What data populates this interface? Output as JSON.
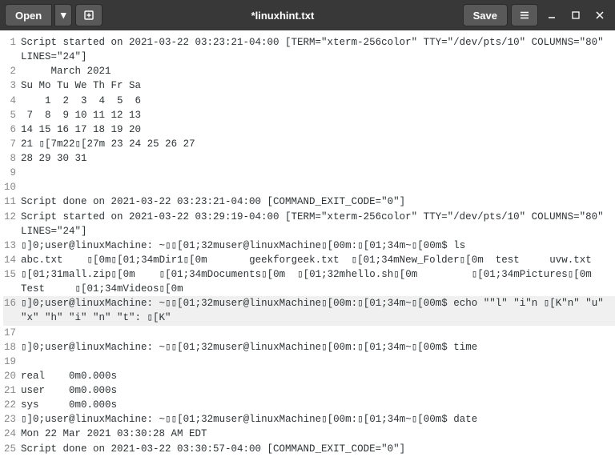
{
  "titlebar": {
    "open_label": "Open",
    "title": "*linuxhint.txt",
    "save_label": "Save"
  },
  "lines": [
    {
      "n": "1",
      "t": "Script started on 2021-03-22 03:23:21-04:00 [TERM=\"xterm-256color\" TTY=\"/dev/pts/10\" COLUMNS=\"80\" LINES=\"24\"]"
    },
    {
      "n": "2",
      "t": "     March 2021"
    },
    {
      "n": "3",
      "t": "Su Mo Tu We Th Fr Sa"
    },
    {
      "n": "4",
      "t": "    1  2  3  4  5  6"
    },
    {
      "n": "5",
      "t": " 7  8  9 10 11 12 13"
    },
    {
      "n": "6",
      "t": "14 15 16 17 18 19 20"
    },
    {
      "n": "7",
      "t": "21 ▯[7m22▯[27m 23 24 25 26 27"
    },
    {
      "n": "8",
      "t": "28 29 30 31"
    },
    {
      "n": "9",
      "t": ""
    },
    {
      "n": "10",
      "t": ""
    },
    {
      "n": "11",
      "t": "Script done on 2021-03-22 03:23:21-04:00 [COMMAND_EXIT_CODE=\"0\"]"
    },
    {
      "n": "12",
      "t": "Script started on 2021-03-22 03:29:19-04:00 [TERM=\"xterm-256color\" TTY=\"/dev/pts/10\" COLUMNS=\"80\" LINES=\"24\"]"
    },
    {
      "n": "13",
      "t": "▯]0;user@linuxMachine: ~▯▯[01;32muser@linuxMachine▯[00m:▯[01;34m~▯[00m$ ls"
    },
    {
      "n": "14",
      "t": "abc.txt    ▯[0m▯[01;34mDir1▯[0m       geekforgeek.txt  ▯[01;34mNew_Folder▯[0m  test     uvw.txt"
    },
    {
      "n": "15",
      "t": "▯[01;31mall.zip▯[0m    ▯[01;34mDocuments▯[0m  ▯[01;32mhello.sh▯[0m         ▯[01;34mPictures▯[0m    Test     ▯[01;34mVideos▯[0m"
    },
    {
      "n": "16",
      "t": "▯]0;user@linuxMachine: ~▯▯[01;32muser@linuxMachine▯[00m:▯[01;34m~▯[00m$ echo \"\"l\" \"i\"n ▯[K\"n\" \"u\" \"x\" \"h\" \"i\" \"n\" \"t\": ▯[K\"",
      "hl": true
    },
    {
      "n": "17",
      "t": ""
    },
    {
      "n": "18",
      "t": "▯]0;user@linuxMachine: ~▯▯[01;32muser@linuxMachine▯[00m:▯[01;34m~▯[00m$ time"
    },
    {
      "n": "19",
      "t": ""
    },
    {
      "n": "20",
      "t": "real    0m0.000s"
    },
    {
      "n": "21",
      "t": "user    0m0.000s"
    },
    {
      "n": "22",
      "t": "sys     0m0.000s"
    },
    {
      "n": "23",
      "t": "▯]0;user@linuxMachine: ~▯▯[01;32muser@linuxMachine▯[00m:▯[01;34m~▯[00m$ date"
    },
    {
      "n": "24",
      "t": "Mon 22 Mar 2021 03:30:28 AM EDT"
    },
    {
      "n": "25",
      "t": "Script done on 2021-03-22 03:30:57-04:00 [COMMAND_EXIT_CODE=\"0\"]"
    }
  ]
}
